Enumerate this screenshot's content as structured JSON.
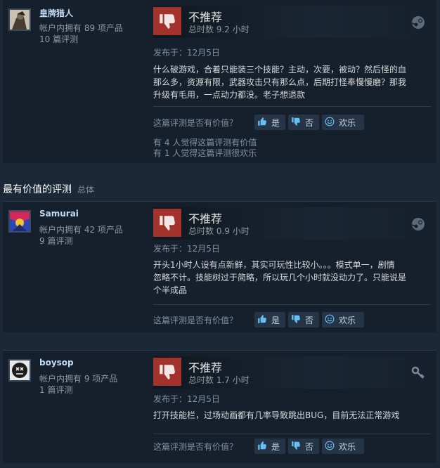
{
  "section": {
    "title": "最有价值的评测",
    "subtitle": "总体"
  },
  "reviews": [
    {
      "author": "皇牌猎人",
      "products": "帐户内拥有 89 项产品",
      "reviews": "10 篇评测",
      "recommendation": "不推荐",
      "hours": "总时数 9.2 小时",
      "posted": "发布于：12月5日",
      "content": [
        "什么破游戏，合着只能装三个技能？主动，次要，被动？然后怪的血",
        "那么多，资源有限，武器攻击只有那么点，后期打怪奉慢慢磨？那我",
        "升级有毛用，一点动力都没。老子想退款"
      ],
      "helpful_question": "这篇评测是否有价值？",
      "yes_label": "是",
      "no_label": "否",
      "funny_label": "欢乐",
      "found_helpful": "有 4 人觉得这篇评测有价值",
      "found_funny": "有 1 人觉得这篇评测很欢乐",
      "platform_icon": "steam-icon"
    },
    {
      "author": "Samurai",
      "products": "帐户内拥有 42 项产品",
      "reviews": "9 篇评测",
      "recommendation": "不推荐",
      "hours": "总时数 0.9 小时",
      "posted": "发布于：12月5日",
      "content": [
        "开头1小时人设有点新鲜，其实可玩性比较小。。。模式单一，剧情",
        "忽略不计。技能树过于简略，所以玩几个小时就没动力了。只能说是",
        "个半成品"
      ],
      "helpful_question": "这篇评测是否有价值？",
      "yes_label": "是",
      "no_label": "否",
      "funny_label": "欢乐",
      "platform_icon": "steam-icon"
    },
    {
      "author": "boysop",
      "products": "帐户内拥有 9 项产品",
      "reviews": "1 篇评测",
      "recommendation": "不推荐",
      "hours": "总时数 1.7 小时",
      "posted": "发布于：12月5日",
      "content": [
        "打开技能栏，过场动画都有几率导致跳出BUG，目前无法正常游戏"
      ],
      "helpful_question": "这篇评测是否有价值？",
      "yes_label": "是",
      "no_label": "否",
      "funny_label": "欢乐",
      "platform_icon": "key-icon"
    }
  ]
}
